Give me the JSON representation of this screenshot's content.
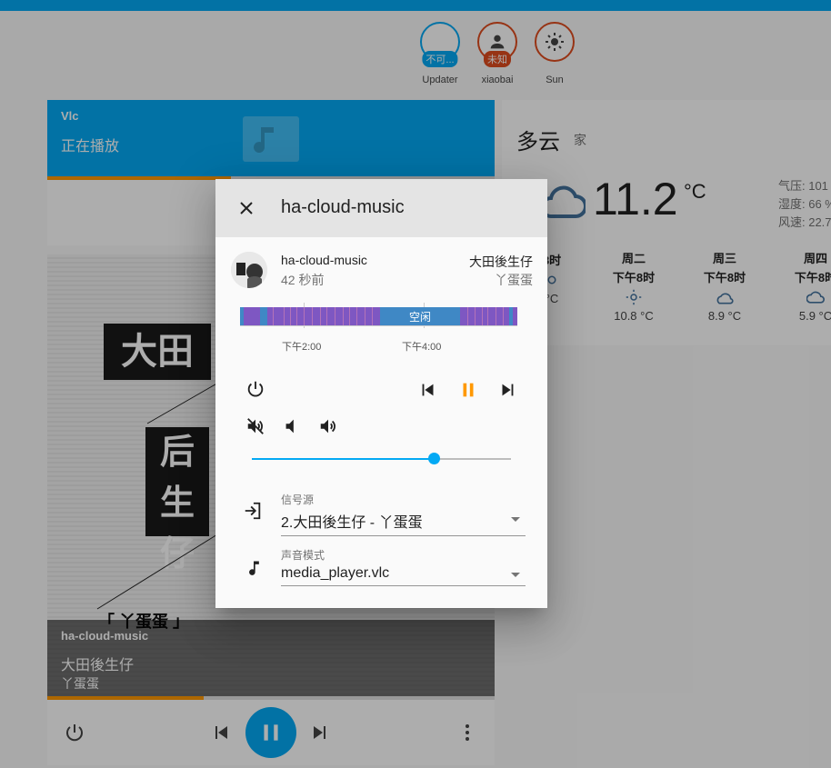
{
  "badges": [
    {
      "state": "不可...",
      "name": "Updater",
      "variant": "blue"
    },
    {
      "state": "未知",
      "name": "xiaobai",
      "variant": "red"
    },
    {
      "state": "",
      "name": "Sun",
      "variant": "red"
    }
  ],
  "vlc_card": {
    "source": "Vlc",
    "state": "正在播放",
    "progress": 0.41
  },
  "player_card": {
    "album_words": [
      "大田",
      "后生",
      "仔",
      "「 丫蛋蛋 」"
    ],
    "source": "ha-cloud-music",
    "title": "大田後生仔",
    "artist": "丫蛋蛋",
    "progress": 0.35
  },
  "weather": {
    "condition": "多云",
    "location": "家",
    "temperature": "11.2",
    "unit": "°C",
    "attributes": [
      "气压: 101",
      "湿度: 66 %",
      "风速: 22.7"
    ],
    "forecast": [
      {
        "day": "",
        "hour": "8时",
        "icon": "partly-snowy-icon",
        "temp": "°C"
      },
      {
        "day": "周二",
        "hour": "下午8时",
        "icon": "sunny-icon",
        "temp": "10.8 °C"
      },
      {
        "day": "周三",
        "hour": "下午8时",
        "icon": "partly-cloudy-night-icon",
        "temp": "8.9 °C"
      },
      {
        "day": "周四",
        "hour": "下午8时",
        "icon": "cloudy-icon",
        "temp": "5.9 °C"
      }
    ]
  },
  "dialog": {
    "title": "ha-cloud-music",
    "entity_name": "ha-cloud-music",
    "last_changed": "42 秒前",
    "media_title": "大田後生仔",
    "media_artist": "丫蛋蛋",
    "timeline": {
      "idle_label": "空闲",
      "ticks": [
        "下午2:00",
        "下午4:00"
      ]
    },
    "volume_level": 0.7,
    "source_label": "信号源",
    "source_value": "2.大田後生仔 - 丫蛋蛋",
    "sound_mode_label": "声音模式",
    "sound_mode_value": "media_player.vlc"
  },
  "colors": {
    "accent": "#03a9f4",
    "progress": "#ff9800",
    "pause": "#ff9800",
    "badge_red": "#df4c1e"
  }
}
